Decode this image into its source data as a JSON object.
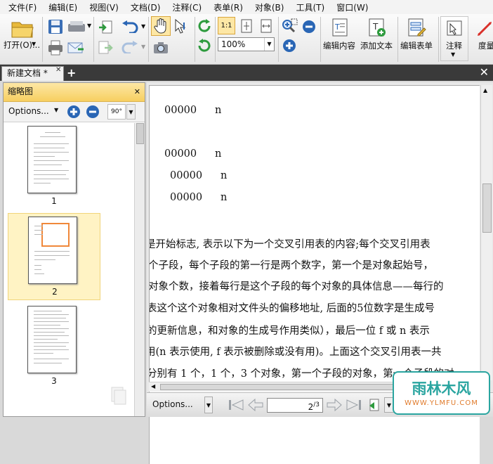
{
  "menu": [
    "文件(F)",
    "编辑(E)",
    "视图(V)",
    "文档(D)",
    "注释(C)",
    "表单(R)",
    "对象(B)",
    "工具(T)",
    "窗口(W)"
  ],
  "toolbar": {
    "open_label": "打开(O)...",
    "zoom_value": "100%",
    "edit_content_label": "编辑内容",
    "add_text_label": "添加文本",
    "edit_form_label": "编辑表单",
    "annotate_label": "注释",
    "measure_label": "度量",
    "actual_size_label": "1:1"
  },
  "tabs": {
    "doc_tab_label": "新建文档 *"
  },
  "sidebar": {
    "title": "缩略图",
    "options_label": "Options...",
    "rotate_label": "90°",
    "thumbnails": [
      {
        "page": "1",
        "selected": false
      },
      {
        "page": "2",
        "selected": true
      },
      {
        "page": "3",
        "selected": false
      }
    ]
  },
  "document": {
    "xref_lines": [
      {
        "num": "00000",
        "flag": "n"
      },
      {
        "num": "00000",
        "flag": "n"
      },
      {
        "num": "00000",
        "flag": "n"
      },
      {
        "num": "00000",
        "flag": "n"
      }
    ],
    "paragraph": [
      "是开始标志, 表示以下为一个交叉引用表的内容;每个交叉引用表",
      "个子段，每个子段的第一行是两个数字，第一个是对象起始号，",
      "对象个数，接着每行是这个子段的每个对象的具体信息——每行的",
      "表这个这个对象相对文件头的偏移地址, 后面的5位数字是生成号",
      "的更新信息，和对象的生成号作用类似），最后一位 f 或 n 表示",
      "用(n 表示使用, f 表示被删除或没有用)。上面这个交叉引用表一共",
      "分别有 1 个，1 个，3 个对象，第一个子段的对象，第一个子段的对"
    ]
  },
  "statusbar": {
    "options_label": "Options...",
    "current_page": "2",
    "total_pages": "3"
  },
  "watermark": {
    "text": "雨林木风",
    "url": "WWW.YLMFU.COM"
  }
}
